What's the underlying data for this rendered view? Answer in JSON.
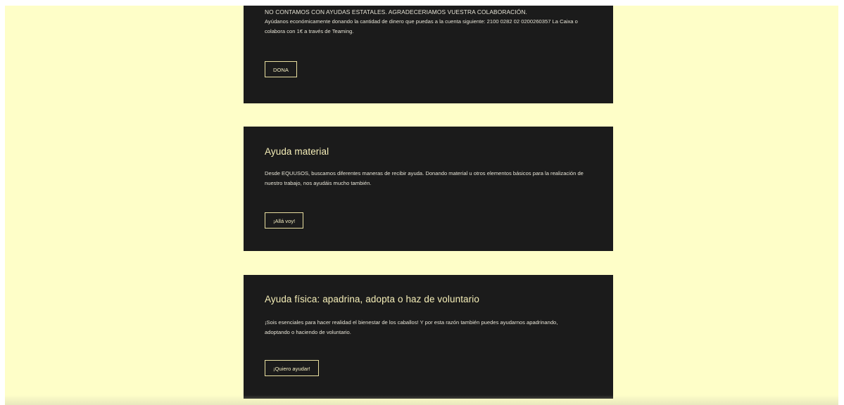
{
  "donation": {
    "notice": "NO CONTAMOS CON AYUDAS ESTATALES. AGRADECERIAMOS VUESTRA COLABORACIÓN.",
    "text": "Ayúdanos económicamente donando la cantidad de dinero que puedas a la cuenta siguiente: 2100 0282 02 0200260357 La Caixa o colabora con 1€ a través de Teaming.",
    "button_label": "DONA"
  },
  "material": {
    "title": "Ayuda material",
    "text": "Desde EQUUSOS, buscamos diferentes maneras de recibir ayuda. Donando material u otros elementos básicos para la realización de nuestro trabajo, nos ayudáis mucho también.",
    "button_label": "¡Allá voy!"
  },
  "physical": {
    "title": "Ayuda física: apadrina, adopta o haz de voluntario",
    "text": "¡Sois esenciales para hacer realidad el bienestar de los caballos! Y por esta razón también puedes ayudarnos apadrinando, adoptando o haciendo de voluntario.",
    "button_label": "¡Quiero ayudar!"
  },
  "colors": {
    "background": "#fefec8",
    "card": "#1b1b1b",
    "accent": "#f6efb8"
  }
}
